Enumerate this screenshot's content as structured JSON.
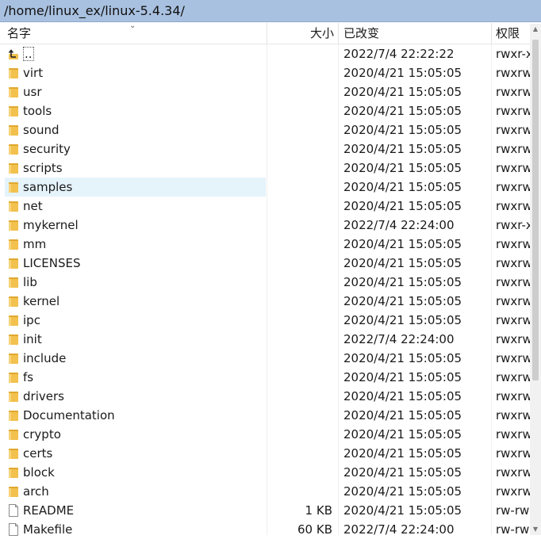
{
  "path": "/home/linux_ex/linux-5.4.34/",
  "columns": {
    "name": "名字",
    "size": "大小",
    "modified": "已改变",
    "permissions": "权限"
  },
  "rows": [
    {
      "type": "up",
      "name": "..",
      "size": "",
      "date": "2022/7/4 22:22:22",
      "perm": "rwxr-x"
    },
    {
      "type": "folder",
      "name": "virt",
      "size": "",
      "date": "2020/4/21 15:05:05",
      "perm": "rwxrw"
    },
    {
      "type": "folder",
      "name": "usr",
      "size": "",
      "date": "2020/4/21 15:05:05",
      "perm": "rwxrw"
    },
    {
      "type": "folder",
      "name": "tools",
      "size": "",
      "date": "2020/4/21 15:05:05",
      "perm": "rwxrw"
    },
    {
      "type": "folder",
      "name": "sound",
      "size": "",
      "date": "2020/4/21 15:05:05",
      "perm": "rwxrw"
    },
    {
      "type": "folder",
      "name": "security",
      "size": "",
      "date": "2020/4/21 15:05:05",
      "perm": "rwxrw"
    },
    {
      "type": "folder",
      "name": "scripts",
      "size": "",
      "date": "2020/4/21 15:05:05",
      "perm": "rwxrw"
    },
    {
      "type": "folder",
      "name": "samples",
      "size": "",
      "date": "2020/4/21 15:05:05",
      "perm": "rwxrw",
      "selected": true
    },
    {
      "type": "folder",
      "name": "net",
      "size": "",
      "date": "2020/4/21 15:05:05",
      "perm": "rwxrw"
    },
    {
      "type": "folder",
      "name": "mykernel",
      "size": "",
      "date": "2022/7/4 22:24:00",
      "perm": "rwxr-x"
    },
    {
      "type": "folder",
      "name": "mm",
      "size": "",
      "date": "2020/4/21 15:05:05",
      "perm": "rwxrw"
    },
    {
      "type": "folder",
      "name": "LICENSES",
      "size": "",
      "date": "2020/4/21 15:05:05",
      "perm": "rwxrw"
    },
    {
      "type": "folder",
      "name": "lib",
      "size": "",
      "date": "2020/4/21 15:05:05",
      "perm": "rwxrw"
    },
    {
      "type": "folder",
      "name": "kernel",
      "size": "",
      "date": "2020/4/21 15:05:05",
      "perm": "rwxrw"
    },
    {
      "type": "folder",
      "name": "ipc",
      "size": "",
      "date": "2020/4/21 15:05:05",
      "perm": "rwxrw"
    },
    {
      "type": "folder",
      "name": "init",
      "size": "",
      "date": "2022/7/4 22:24:00",
      "perm": "rwxrw"
    },
    {
      "type": "folder",
      "name": "include",
      "size": "",
      "date": "2020/4/21 15:05:05",
      "perm": "rwxrw"
    },
    {
      "type": "folder",
      "name": "fs",
      "size": "",
      "date": "2020/4/21 15:05:05",
      "perm": "rwxrw"
    },
    {
      "type": "folder",
      "name": "drivers",
      "size": "",
      "date": "2020/4/21 15:05:05",
      "perm": "rwxrw"
    },
    {
      "type": "folder",
      "name": "Documentation",
      "size": "",
      "date": "2020/4/21 15:05:05",
      "perm": "rwxrw"
    },
    {
      "type": "folder",
      "name": "crypto",
      "size": "",
      "date": "2020/4/21 15:05:05",
      "perm": "rwxrw"
    },
    {
      "type": "folder",
      "name": "certs",
      "size": "",
      "date": "2020/4/21 15:05:05",
      "perm": "rwxrw"
    },
    {
      "type": "folder",
      "name": "block",
      "size": "",
      "date": "2020/4/21 15:05:05",
      "perm": "rwxrw"
    },
    {
      "type": "folder",
      "name": "arch",
      "size": "",
      "date": "2020/4/21 15:05:05",
      "perm": "rwxrw"
    },
    {
      "type": "file",
      "name": "README",
      "size": "1 KB",
      "date": "2020/4/21 15:05:05",
      "perm": "rw-rw"
    },
    {
      "type": "file",
      "name": "Makefile",
      "size": "60 KB",
      "date": "2022/7/4 22:24:00",
      "perm": "rw-rw"
    }
  ],
  "icons": {
    "folder": "folder-icon",
    "file": "file-icon",
    "up": "parent-dir-icon",
    "sort": "sort-descending-icon"
  },
  "colors": {
    "path_bar": "#a9c1e0",
    "selection": "#e5f3fb",
    "folder": "#f2c14e"
  }
}
